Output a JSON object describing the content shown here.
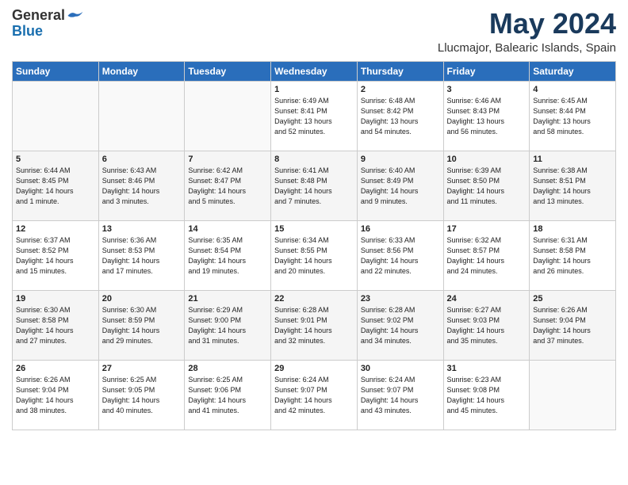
{
  "header": {
    "logo_general": "General",
    "logo_blue": "Blue",
    "month_title": "May 2024",
    "location": "Llucmajor, Balearic Islands, Spain"
  },
  "days_of_week": [
    "Sunday",
    "Monday",
    "Tuesday",
    "Wednesday",
    "Thursday",
    "Friday",
    "Saturday"
  ],
  "weeks": [
    [
      {
        "day": "",
        "info": ""
      },
      {
        "day": "",
        "info": ""
      },
      {
        "day": "",
        "info": ""
      },
      {
        "day": "1",
        "info": "Sunrise: 6:49 AM\nSunset: 8:41 PM\nDaylight: 13 hours\nand 52 minutes."
      },
      {
        "day": "2",
        "info": "Sunrise: 6:48 AM\nSunset: 8:42 PM\nDaylight: 13 hours\nand 54 minutes."
      },
      {
        "day": "3",
        "info": "Sunrise: 6:46 AM\nSunset: 8:43 PM\nDaylight: 13 hours\nand 56 minutes."
      },
      {
        "day": "4",
        "info": "Sunrise: 6:45 AM\nSunset: 8:44 PM\nDaylight: 13 hours\nand 58 minutes."
      }
    ],
    [
      {
        "day": "5",
        "info": "Sunrise: 6:44 AM\nSunset: 8:45 PM\nDaylight: 14 hours\nand 1 minute."
      },
      {
        "day": "6",
        "info": "Sunrise: 6:43 AM\nSunset: 8:46 PM\nDaylight: 14 hours\nand 3 minutes."
      },
      {
        "day": "7",
        "info": "Sunrise: 6:42 AM\nSunset: 8:47 PM\nDaylight: 14 hours\nand 5 minutes."
      },
      {
        "day": "8",
        "info": "Sunrise: 6:41 AM\nSunset: 8:48 PM\nDaylight: 14 hours\nand 7 minutes."
      },
      {
        "day": "9",
        "info": "Sunrise: 6:40 AM\nSunset: 8:49 PM\nDaylight: 14 hours\nand 9 minutes."
      },
      {
        "day": "10",
        "info": "Sunrise: 6:39 AM\nSunset: 8:50 PM\nDaylight: 14 hours\nand 11 minutes."
      },
      {
        "day": "11",
        "info": "Sunrise: 6:38 AM\nSunset: 8:51 PM\nDaylight: 14 hours\nand 13 minutes."
      }
    ],
    [
      {
        "day": "12",
        "info": "Sunrise: 6:37 AM\nSunset: 8:52 PM\nDaylight: 14 hours\nand 15 minutes."
      },
      {
        "day": "13",
        "info": "Sunrise: 6:36 AM\nSunset: 8:53 PM\nDaylight: 14 hours\nand 17 minutes."
      },
      {
        "day": "14",
        "info": "Sunrise: 6:35 AM\nSunset: 8:54 PM\nDaylight: 14 hours\nand 19 minutes."
      },
      {
        "day": "15",
        "info": "Sunrise: 6:34 AM\nSunset: 8:55 PM\nDaylight: 14 hours\nand 20 minutes."
      },
      {
        "day": "16",
        "info": "Sunrise: 6:33 AM\nSunset: 8:56 PM\nDaylight: 14 hours\nand 22 minutes."
      },
      {
        "day": "17",
        "info": "Sunrise: 6:32 AM\nSunset: 8:57 PM\nDaylight: 14 hours\nand 24 minutes."
      },
      {
        "day": "18",
        "info": "Sunrise: 6:31 AM\nSunset: 8:58 PM\nDaylight: 14 hours\nand 26 minutes."
      }
    ],
    [
      {
        "day": "19",
        "info": "Sunrise: 6:30 AM\nSunset: 8:58 PM\nDaylight: 14 hours\nand 27 minutes."
      },
      {
        "day": "20",
        "info": "Sunrise: 6:30 AM\nSunset: 8:59 PM\nDaylight: 14 hours\nand 29 minutes."
      },
      {
        "day": "21",
        "info": "Sunrise: 6:29 AM\nSunset: 9:00 PM\nDaylight: 14 hours\nand 31 minutes."
      },
      {
        "day": "22",
        "info": "Sunrise: 6:28 AM\nSunset: 9:01 PM\nDaylight: 14 hours\nand 32 minutes."
      },
      {
        "day": "23",
        "info": "Sunrise: 6:28 AM\nSunset: 9:02 PM\nDaylight: 14 hours\nand 34 minutes."
      },
      {
        "day": "24",
        "info": "Sunrise: 6:27 AM\nSunset: 9:03 PM\nDaylight: 14 hours\nand 35 minutes."
      },
      {
        "day": "25",
        "info": "Sunrise: 6:26 AM\nSunset: 9:04 PM\nDaylight: 14 hours\nand 37 minutes."
      }
    ],
    [
      {
        "day": "26",
        "info": "Sunrise: 6:26 AM\nSunset: 9:04 PM\nDaylight: 14 hours\nand 38 minutes."
      },
      {
        "day": "27",
        "info": "Sunrise: 6:25 AM\nSunset: 9:05 PM\nDaylight: 14 hours\nand 40 minutes."
      },
      {
        "day": "28",
        "info": "Sunrise: 6:25 AM\nSunset: 9:06 PM\nDaylight: 14 hours\nand 41 minutes."
      },
      {
        "day": "29",
        "info": "Sunrise: 6:24 AM\nSunset: 9:07 PM\nDaylight: 14 hours\nand 42 minutes."
      },
      {
        "day": "30",
        "info": "Sunrise: 6:24 AM\nSunset: 9:07 PM\nDaylight: 14 hours\nand 43 minutes."
      },
      {
        "day": "31",
        "info": "Sunrise: 6:23 AM\nSunset: 9:08 PM\nDaylight: 14 hours\nand 45 minutes."
      },
      {
        "day": "",
        "info": ""
      }
    ]
  ]
}
